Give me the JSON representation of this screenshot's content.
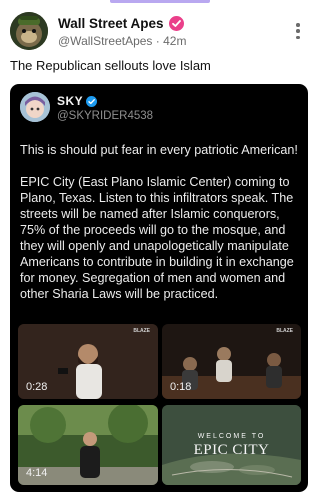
{
  "post": {
    "author_name": "Wall Street Apes",
    "handle": "@WallStreetApes",
    "separator": "·",
    "time_ago": "42m",
    "text": "The Republican sellouts love Islam"
  },
  "quoted_post": {
    "author_name": "SKY",
    "handle": "@SKYRIDER4538",
    "paragraph_1": "This is should put fear in every patriotic American!",
    "paragraph_2": "EPIC City (East Plano Islamic Center) coming to Plano, Texas. Listen to this infiltrators speak. The streets will be named after Islamic conquerors, 75% of the proceeds will go to the mosque, and they will openly and unapologetically manipulate Americans to contribute in building it in exchange for money. Segregation of men and women and other Sharia Laws will be practiced.",
    "media": [
      {
        "duration": "0:28",
        "logo": "BLAZE"
      },
      {
        "duration": "0:18",
        "logo": "BLAZE"
      },
      {
        "duration": "4:14"
      },
      {
        "overlay_small": "WELCOME TO",
        "overlay_big": "EPIC CITY"
      }
    ]
  },
  "icons": {
    "verified_badge": "pink-check-badge-icon",
    "blue_check": "blue-check-icon",
    "more": "vertical-ellipsis-icon"
  },
  "colors": {
    "badge_pink": "#ea3f8a",
    "blue_check": "#1d9bf0",
    "embed_bg": "#000000",
    "accent_bar": "#b9a8f0"
  }
}
